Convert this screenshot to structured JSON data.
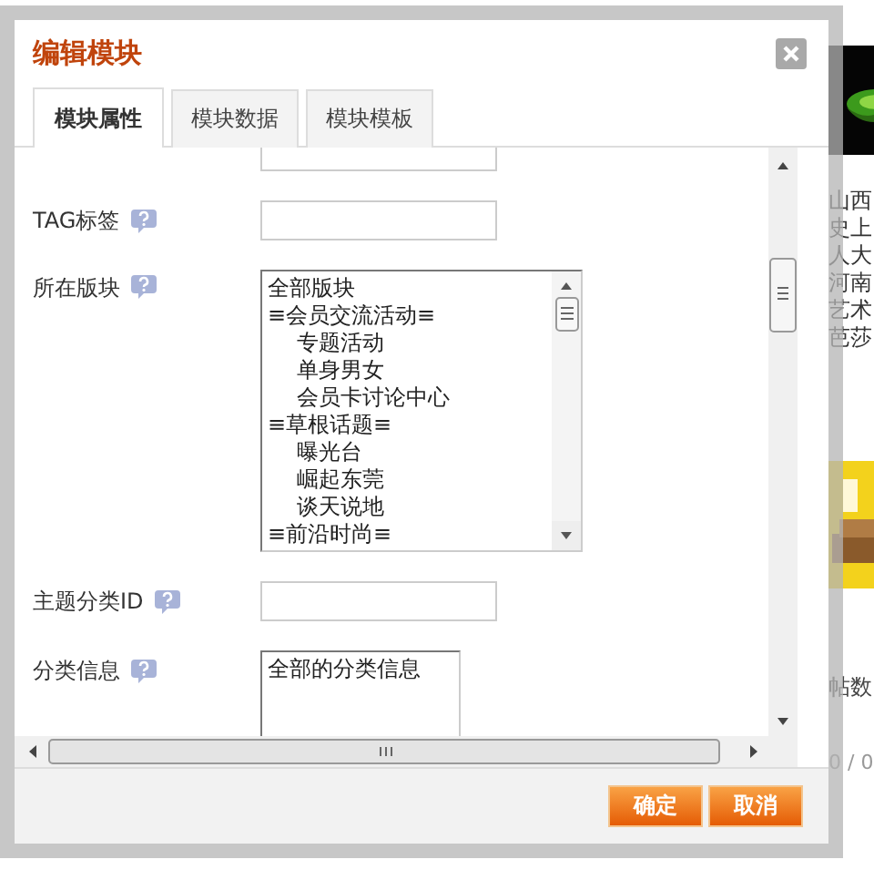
{
  "background": {
    "side_texts": [
      "山西",
      "史上",
      "人大",
      "河南",
      "艺术",
      "芭莎"
    ],
    "post_label": "帖数",
    "pager": "0 / 0"
  },
  "dialog": {
    "title": "编辑模块",
    "tabs": [
      {
        "label": "模块属性",
        "selected": true
      },
      {
        "label": "模块数据",
        "selected": false
      },
      {
        "label": "模块模板",
        "selected": false
      }
    ],
    "fields": [
      {
        "kind": "input"
      },
      {
        "kind": "input",
        "label": "TAG标签"
      },
      {
        "kind": "listbox",
        "label": "所在版块",
        "options": [
          {
            "label": "全部版块"
          },
          {
            "label": "≡会员交流活动≡",
            "children": [
              {
                "label": "专题活动"
              },
              {
                "label": "单身男女"
              },
              {
                "label": "会员卡讨论中心"
              }
            ]
          },
          {
            "label": "≡草根话题≡",
            "children": [
              {
                "label": "曝光台"
              },
              {
                "label": "崛起东莞"
              },
              {
                "label": "谈天说地"
              }
            ]
          },
          {
            "label": "≡前沿时尚≡"
          }
        ]
      },
      {
        "kind": "input",
        "label": "主题分类ID"
      },
      {
        "kind": "list",
        "label": "分类信息",
        "options": [
          {
            "label": "全部的分类信息"
          }
        ]
      }
    ],
    "buttons": [
      {
        "label": "确定"
      },
      {
        "label": "取消"
      }
    ]
  }
}
